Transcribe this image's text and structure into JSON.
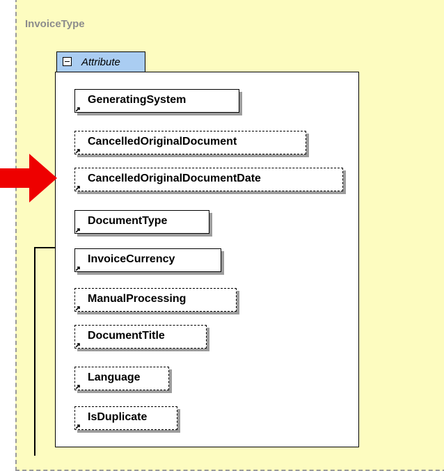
{
  "type_name": "InvoiceType",
  "group": {
    "label": "Attribute",
    "toggle_icon": "collapse-minus-icon"
  },
  "attributes": [
    {
      "name": "GeneratingSystem",
      "required": true
    },
    {
      "name": "CancelledOriginalDocument",
      "required": false
    },
    {
      "name": "CancelledOriginalDocumentDate",
      "required": false,
      "highlighted": true
    },
    {
      "name": "DocumentType",
      "required": true
    },
    {
      "name": "InvoiceCurrency",
      "required": true
    },
    {
      "name": "ManualProcessing",
      "required": false
    },
    {
      "name": "DocumentTitle",
      "required": false
    },
    {
      "name": "Language",
      "required": false
    },
    {
      "name": "IsDuplicate",
      "required": false
    }
  ],
  "colors": {
    "type_bg": "#fdfcc0",
    "tab_bg": "#aacdf2",
    "pointer": "#ee0000"
  }
}
